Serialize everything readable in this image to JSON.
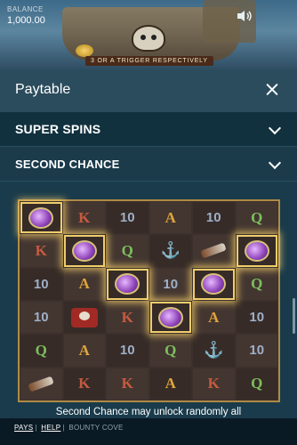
{
  "game": {
    "balance_label": "BALANCE",
    "balance_value": "1,000.00",
    "banner_text": "3 OR A TRIGGER RESPECTIVELY"
  },
  "paytable": {
    "title": "Paytable",
    "sections": [
      {
        "label": "SUPER SPINS"
      },
      {
        "label": "SECOND CHANCE"
      }
    ],
    "grid": [
      [
        "GEM",
        "K",
        "10",
        "A",
        "10",
        "Q"
      ],
      [
        "K",
        "GEM",
        "Q",
        "ANCHOR",
        "SCOPE",
        "GEM"
      ],
      [
        "10",
        "A",
        "GEM",
        "10",
        "GEM",
        "Q"
      ],
      [
        "10",
        "PIRATE",
        "K",
        "GEM",
        "A",
        "10"
      ],
      [
        "Q",
        "A",
        "10",
        "Q",
        "ANCHOR",
        "10"
      ],
      [
        "SCOPE",
        "K",
        "K",
        "A",
        "K",
        "Q"
      ]
    ],
    "caption": "Second Chance may unlock randomly all"
  },
  "footer": {
    "pays": "PAYS",
    "help": "HELP",
    "game_name": "BOUNTY COVE"
  },
  "icons": {
    "sound": "speaker-icon",
    "close": "close-icon",
    "chevron": "chevron-down-icon"
  }
}
